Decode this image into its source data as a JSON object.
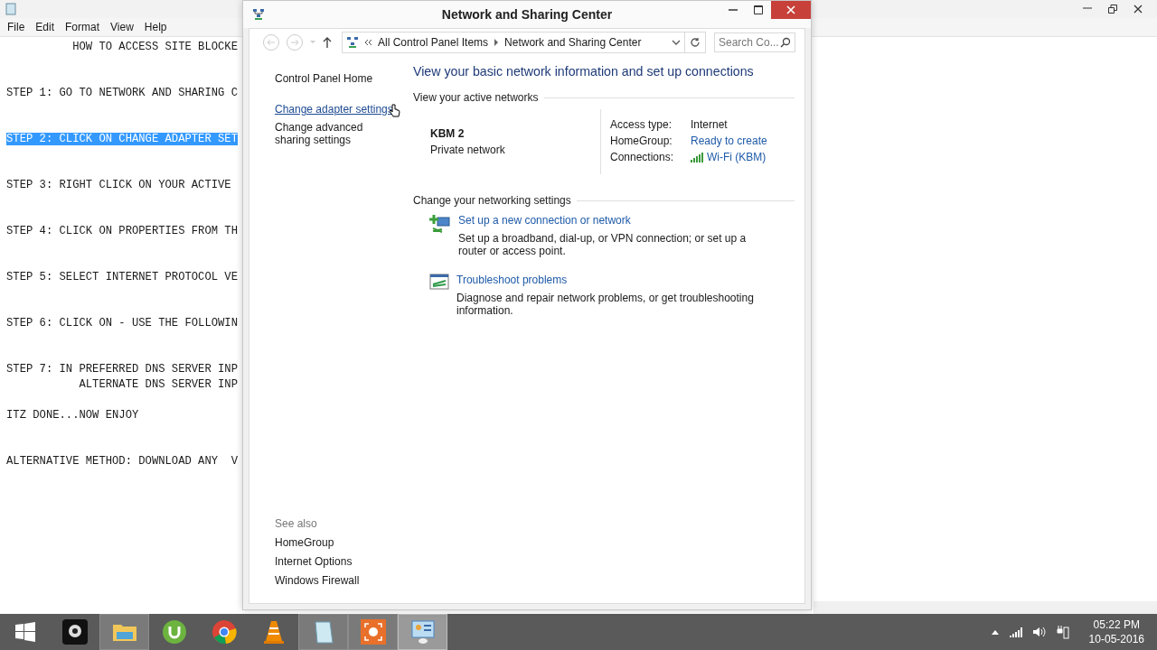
{
  "notepad": {
    "menu": [
      "File",
      "Edit",
      "Format",
      "View",
      "Help"
    ],
    "lines": [
      {
        "text": "          HOW TO ACCESS SITE BLOCKE",
        "selected": false
      },
      {
        "text": "\n\nSTEP 1: GO TO NETWORK AND SHARING C",
        "selected": false
      },
      {
        "text": "\n\nSTEP 2: CLICK ON CHANGE ADAPTER SET",
        "selected": true
      },
      {
        "text": "\n\nSTEP 3: RIGHT CLICK ON YOUR ACTIVE",
        "selected": false
      },
      {
        "text": "\n\nSTEP 4: CLICK ON PROPERTIES FROM TH",
        "selected": false
      },
      {
        "text": "\n\nSTEP 5: SELECT INTERNET PROTOCOL VE",
        "selected": false
      },
      {
        "text": "\n\nSTEP 6: CLICK ON - USE THE FOLLOWIN",
        "selected": false
      },
      {
        "text": "\n\nSTEP 7: IN PREFERRED DNS SERVER INP",
        "selected": false
      },
      {
        "text": "           ALTERNATE DNS SERVER INP",
        "selected": false
      },
      {
        "text": "\nITZ DONE...NOW ENJOY",
        "selected": false
      },
      {
        "text": "\n\nALTERNATIVE METHOD: DOWNLOAD ANY  V",
        "selected": false
      }
    ]
  },
  "window": {
    "title": "Network and Sharing Center",
    "breadcrumb": [
      "All Control Panel Items",
      "Network and Sharing Center"
    ],
    "search": {
      "placeholder": "Search Co..."
    },
    "sidebar": {
      "items": [
        {
          "label": "Control Panel Home",
          "hovered": false
        },
        {
          "label": "Change adapter settings",
          "hovered": true
        },
        {
          "label": "Change advanced sharing settings",
          "hovered": false
        }
      ],
      "see_also": {
        "heading": "See also",
        "items": [
          "HomeGroup",
          "Internet Options",
          "Windows Firewall"
        ]
      }
    },
    "heading": "View your basic network information and set up connections",
    "active_networks": {
      "heading": "View your active networks",
      "network": {
        "name": "KBM  2",
        "type": "Private network"
      },
      "details": [
        {
          "label": "Access type:",
          "value": "Internet",
          "kind": "text"
        },
        {
          "label": "HomeGroup:",
          "value": "Ready to create",
          "kind": "link"
        },
        {
          "label": "Connections:",
          "value": "Wi-Fi (KBM)",
          "kind": "wifi"
        }
      ]
    },
    "networking_settings": {
      "heading": "Change your networking settings",
      "tasks": [
        {
          "kind": "new-connection",
          "title": "Set up a new connection or network",
          "description": "Set up a broadband, dial-up, or VPN connection; or set up a router or access point."
        },
        {
          "kind": "troubleshoot",
          "title": "Troubleshoot problems",
          "description": "Diagnose and repair network problems, or get troubleshooting information."
        }
      ]
    }
  },
  "taskbar": {
    "apps": [
      {
        "kind": "start",
        "open": false,
        "selected": false
      },
      {
        "kind": "camera",
        "open": false,
        "selected": false
      },
      {
        "kind": "explorer",
        "open": true,
        "selected": false
      },
      {
        "kind": "torrent",
        "open": false,
        "selected": false
      },
      {
        "kind": "chrome",
        "open": false,
        "selected": false
      },
      {
        "kind": "vlc",
        "open": false,
        "selected": false
      },
      {
        "kind": "notepad",
        "open": true,
        "selected": false
      },
      {
        "kind": "recorder",
        "open": true,
        "selected": false
      },
      {
        "kind": "control-panel",
        "open": true,
        "selected": true
      }
    ],
    "clock": {
      "time": "05:22 PM",
      "date": "10-05-2016"
    }
  }
}
